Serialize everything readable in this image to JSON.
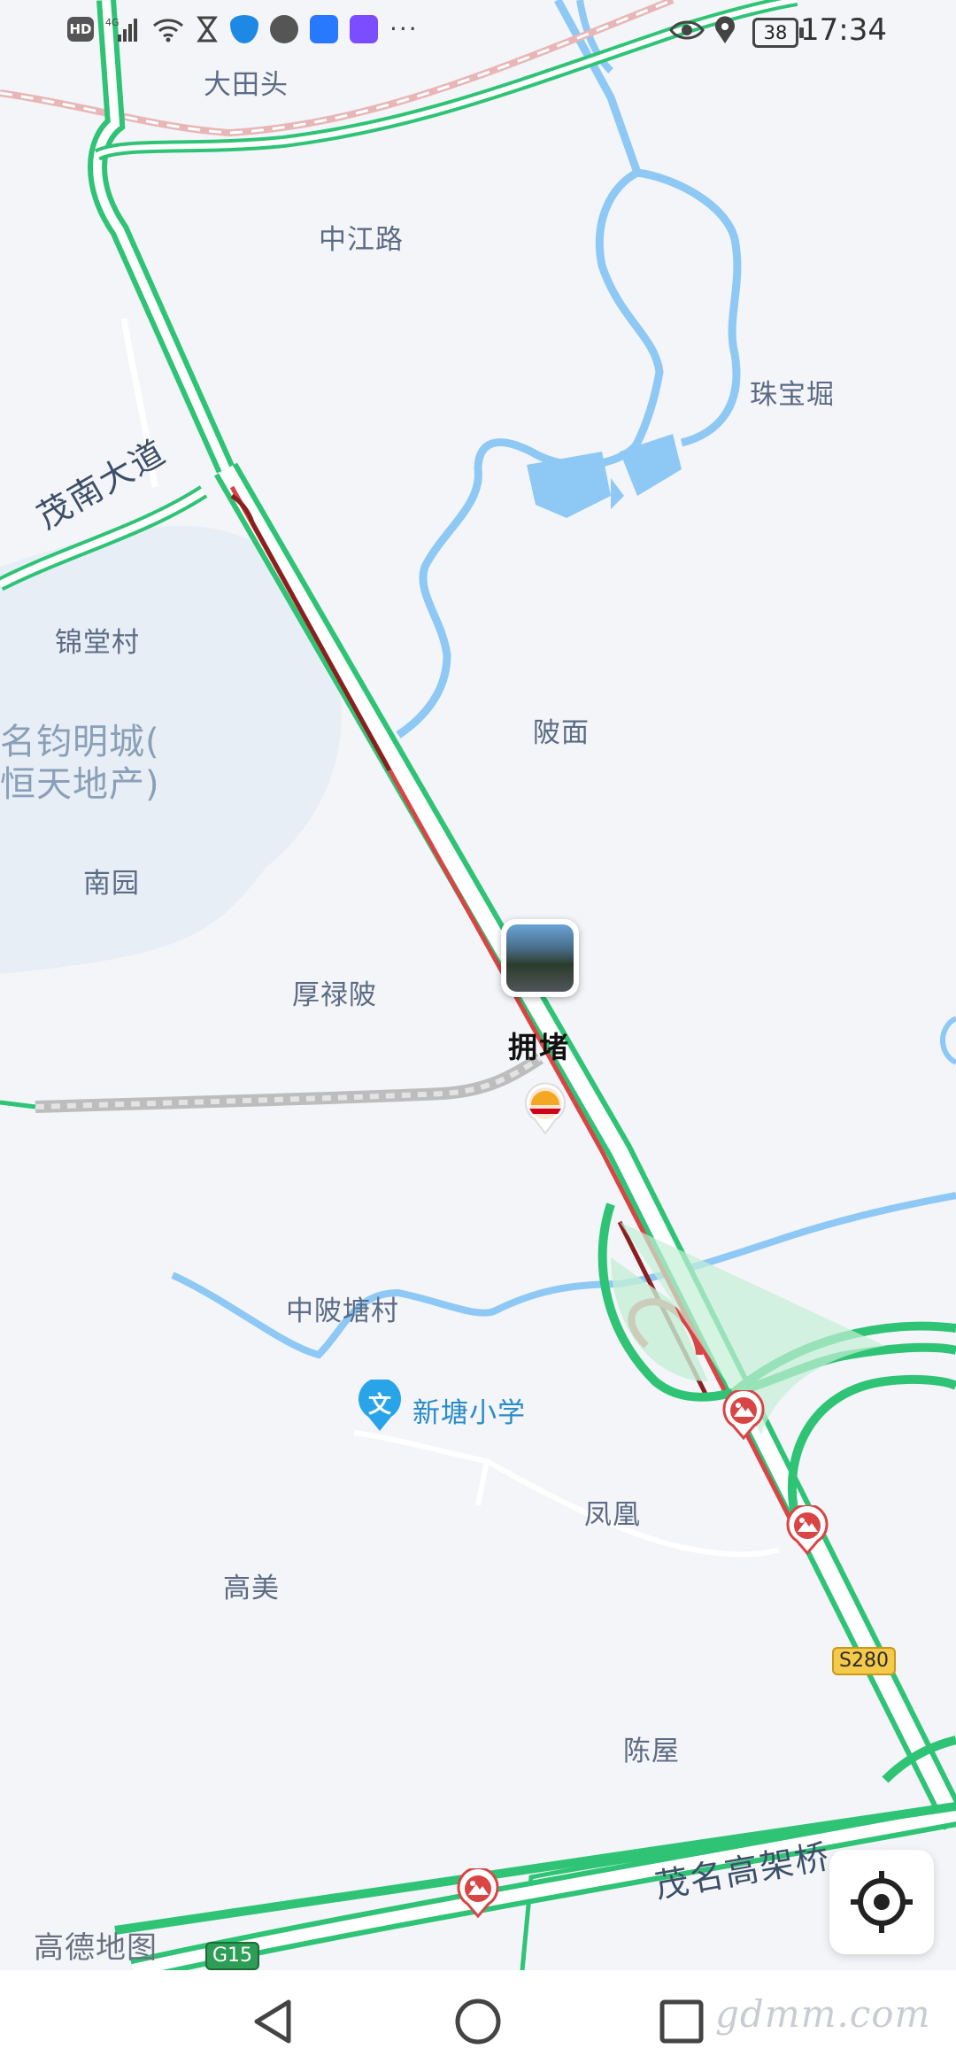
{
  "status_bar": {
    "left_icons": [
      "hd-icon",
      "4g-signal-icon",
      "wifi-icon",
      "hourglass-icon",
      "shield-icon",
      "privacy-icon",
      "cloud-icon",
      "notes-app-icon",
      "more-dots-icon"
    ],
    "hd_label": "HD",
    "more": "···",
    "battery": "38",
    "time": "17:34"
  },
  "map": {
    "places": {
      "datiantou": "大田头",
      "zhongjianglu": "中江路",
      "zhubaoku": "珠宝堀",
      "jintangcun": "锦堂村",
      "mingjun": "名钧明城(",
      "hengtian": "恒天地产)",
      "nanyuan": "南园",
      "pomian": "陂面",
      "houlupo": "厚禄陂",
      "zhongpotangcun": "中陂塘村",
      "xintang_school": "新塘小学",
      "fenghuang": "凤凰",
      "gaomei": "高美",
      "chenwu": "陈屋"
    },
    "roads": {
      "maonan": "茂南大道",
      "maoming_bridge": "茂名高架桥",
      "s280": "S280",
      "g15": "G15"
    },
    "traffic_label": "拥堵",
    "school_badge": "文",
    "brand": "高德地图",
    "watermark": "gdmm.com",
    "colors": {
      "road_green": "#2fc376",
      "jam_red": "#d94545",
      "water": "#8ec8f5"
    }
  },
  "nav_bar": {
    "back": "back-triangle",
    "home": "home-circle",
    "recent": "recent-square"
  }
}
